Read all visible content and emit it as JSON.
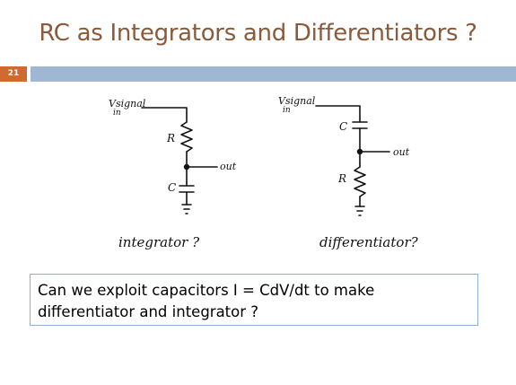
{
  "slide": {
    "title": "RC as Integrators and Differentiators ?",
    "number": "21",
    "accent_color": "#d06b2f",
    "bar_color": "#9fb7d3"
  },
  "figure": {
    "left_circuit": {
      "input_label": "Vsignal",
      "input_sub": "in",
      "top_component": "R",
      "bottom_component": "C",
      "output_label": "out",
      "caption": "integrator ?"
    },
    "right_circuit": {
      "input_label": "Vsignal",
      "input_sub": "in",
      "top_component": "C",
      "bottom_component": "R",
      "output_label": "out",
      "caption": "differentiator?"
    }
  },
  "callout": {
    "text": "Can we exploit capacitors I = CdV/dt to make differentiator and integrator ?"
  }
}
